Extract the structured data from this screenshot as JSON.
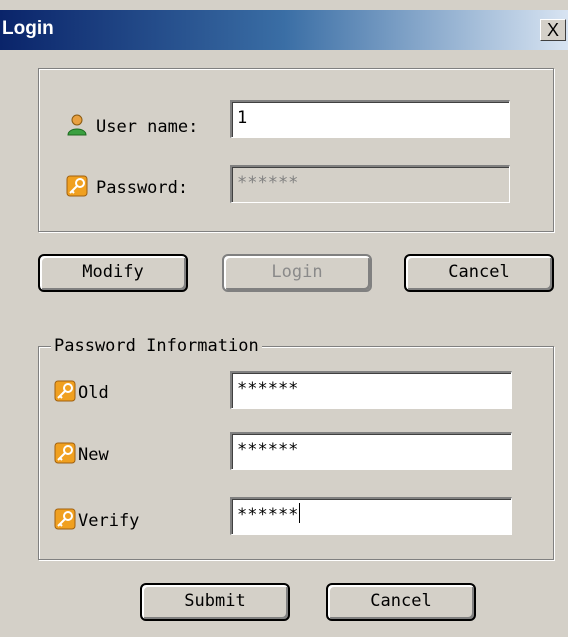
{
  "window": {
    "title": "Login",
    "close_glyph": "X"
  },
  "login": {
    "username_label": "User name:",
    "username_value": "1",
    "password_label": "Password:",
    "password_value": "******",
    "password_enabled": false,
    "user_icon": "user-icon",
    "key_icon": "key-icon"
  },
  "buttons": {
    "modify": "Modify",
    "login": "Login",
    "login_enabled": false,
    "cancel": "Cancel"
  },
  "password_info": {
    "legend": "Password Information",
    "old_label": "Old",
    "old_value": "******",
    "new_label": "New",
    "new_value": "******",
    "verify_label": "Verify",
    "verify_value": "******",
    "submit": "Submit",
    "cancel": "Cancel"
  },
  "colors": {
    "face": "#d4d0c8",
    "title_start": "#0a246a",
    "title_end": "#d8e4f2",
    "key_orange": "#f0a020"
  }
}
